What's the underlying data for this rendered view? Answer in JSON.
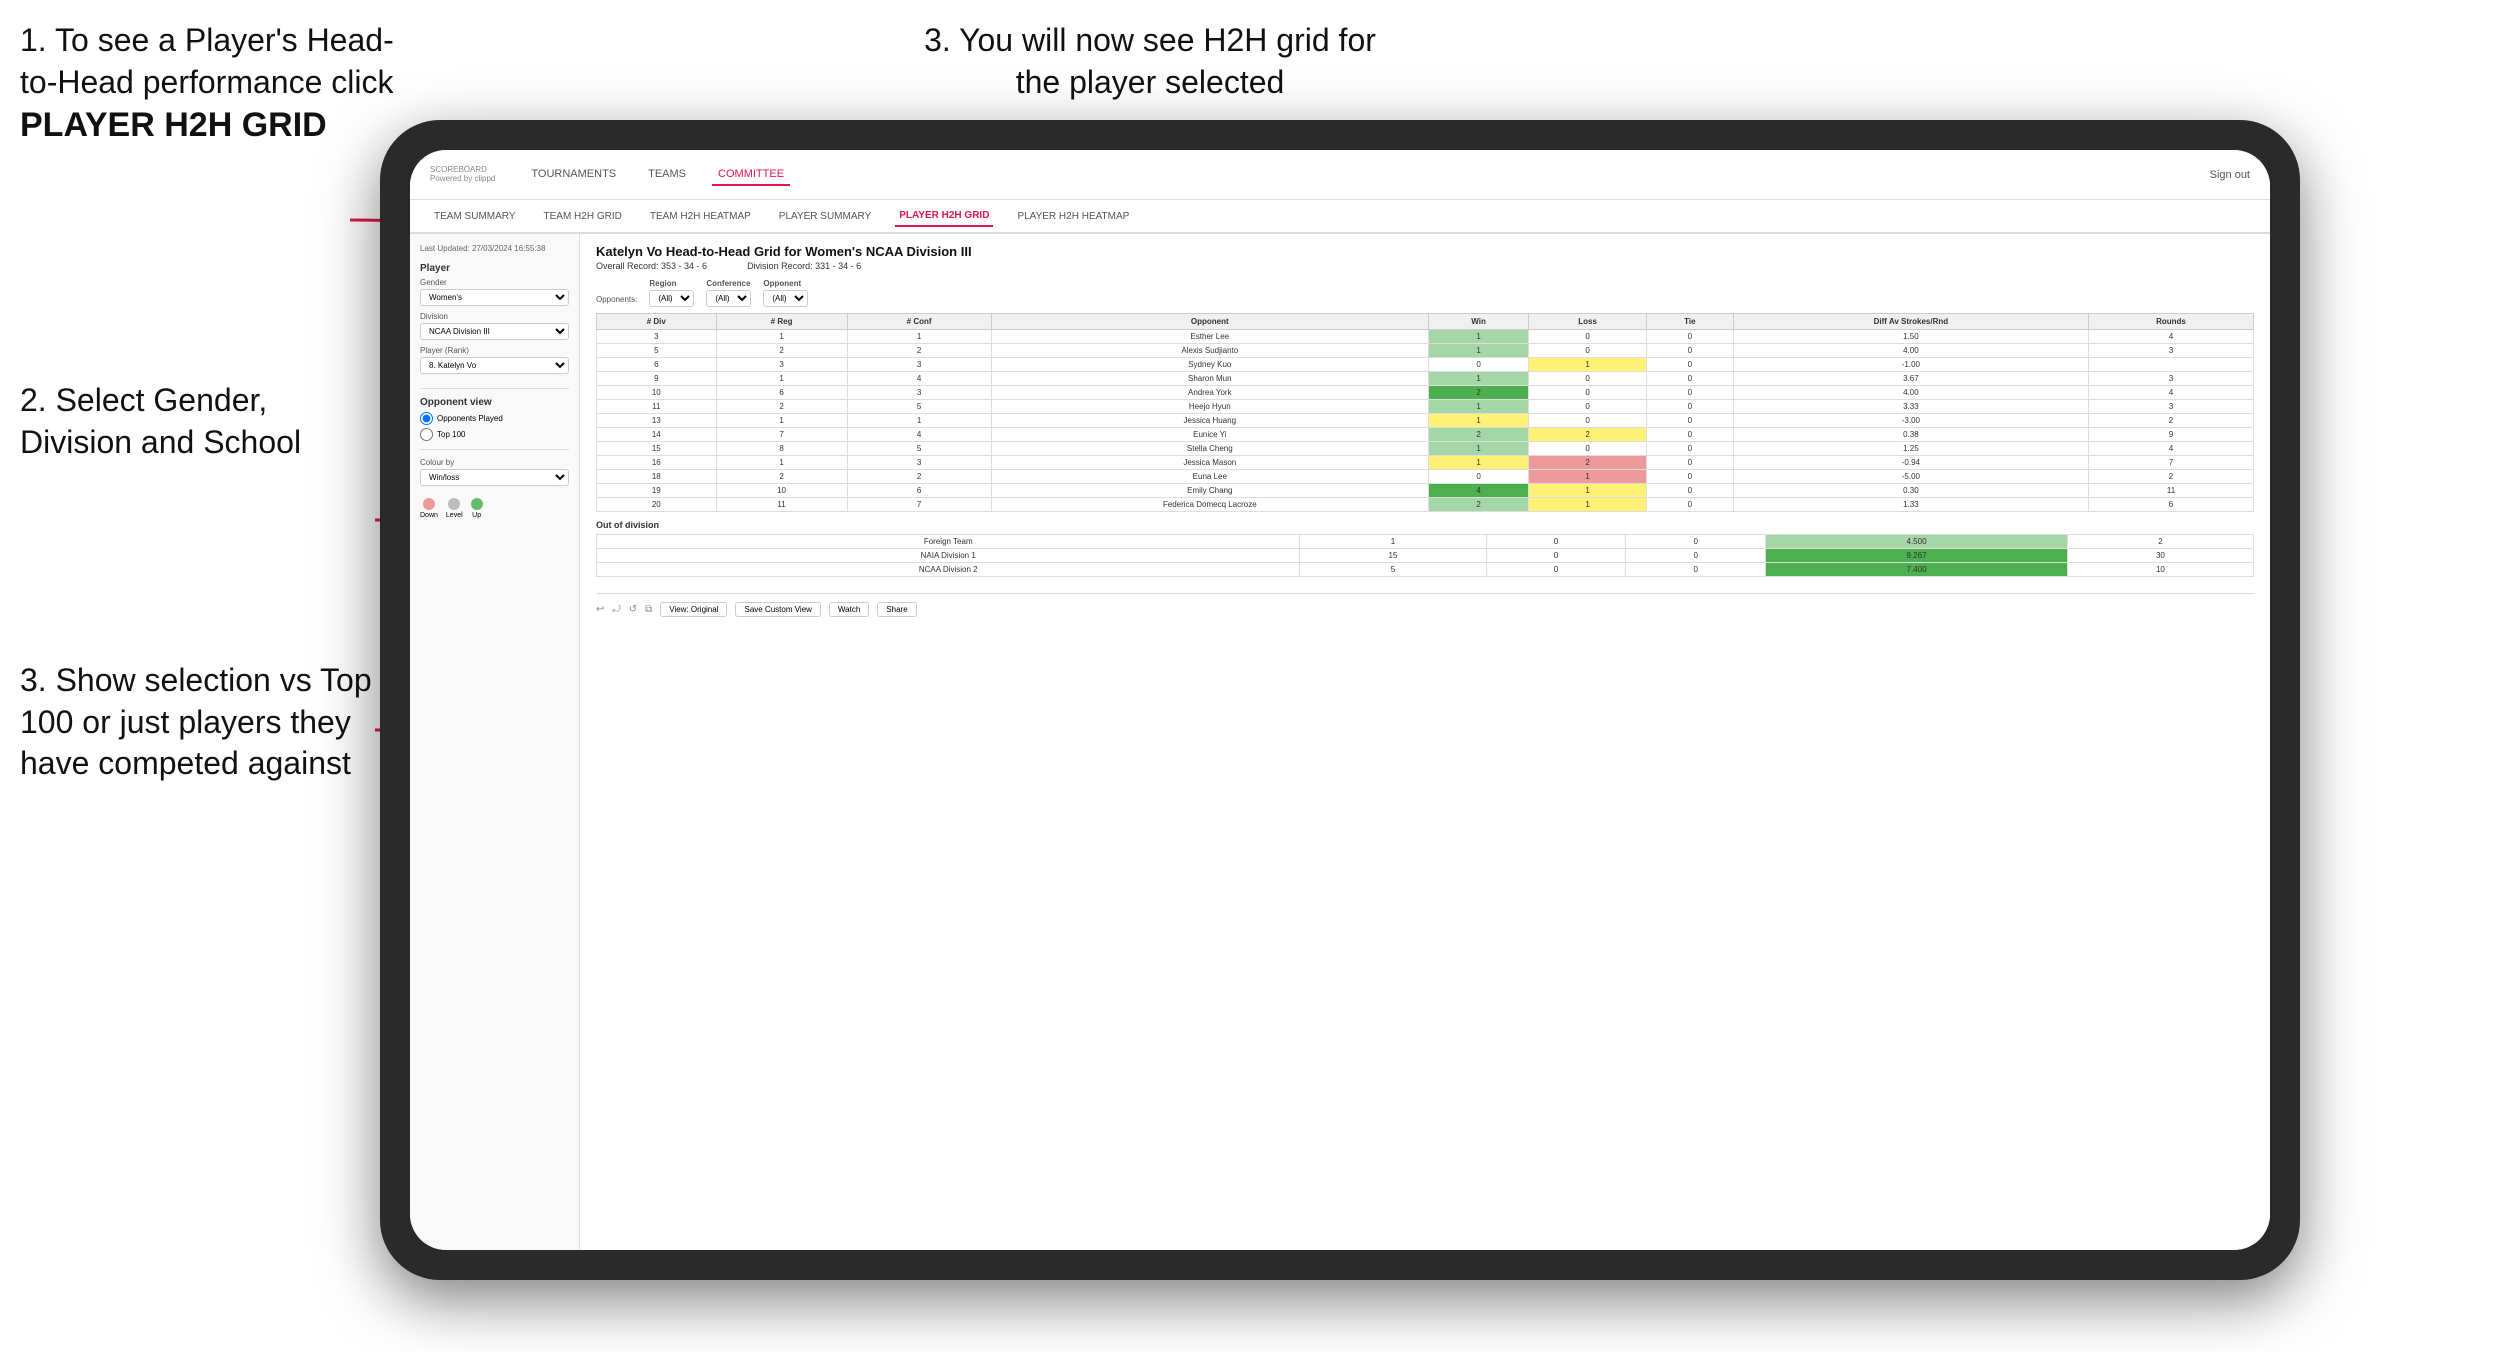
{
  "instructions": {
    "top_left_1": "1. To see a Player's Head-to-Head performance click",
    "top_left_bold": "PLAYER H2H GRID",
    "top_right": "3. You will now see H2H grid for the player selected",
    "mid_left": "2. Select Gender, Division and School",
    "bottom_left": "3. Show selection vs Top 100 or just players they have competed against"
  },
  "nav": {
    "logo": "SCOREBOARD",
    "logo_sub": "Powered by clippd",
    "links": [
      "TOURNAMENTS",
      "TEAMS",
      "COMMITTEE"
    ],
    "active_link": "COMMITTEE",
    "sign_out": "Sign out"
  },
  "sub_nav": {
    "links": [
      "TEAM SUMMARY",
      "TEAM H2H GRID",
      "TEAM H2H HEATMAP",
      "PLAYER SUMMARY",
      "PLAYER H2H GRID",
      "PLAYER H2H HEATMAP"
    ],
    "active": "PLAYER H2H GRID"
  },
  "sidebar": {
    "timestamp": "Last Updated: 27/03/2024 16:55:38",
    "player_section": "Player",
    "gender_label": "Gender",
    "gender_value": "Women's",
    "division_label": "Division",
    "division_value": "NCAA Division III",
    "player_rank_label": "Player (Rank)",
    "player_rank_value": "8. Katelyn Vo",
    "opponent_view_label": "Opponent view",
    "opponent_view_options": [
      "Opponents Played",
      "Top 100"
    ],
    "opponent_view_selected": "Opponents Played",
    "colour_by_label": "Colour by",
    "colour_by_value": "Win/loss",
    "legend": [
      {
        "label": "Down",
        "color": "#ef9a9a"
      },
      {
        "label": "Level",
        "color": "#bdbdbd"
      },
      {
        "label": "Up",
        "color": "#66bb6a"
      }
    ]
  },
  "grid": {
    "title": "Katelyn Vo Head-to-Head Grid for Women's NCAA Division III",
    "overall_record": "Overall Record: 353 - 34 - 6",
    "division_record": "Division Record: 331 - 34 - 6",
    "filters": {
      "region_label": "Region",
      "region_value": "(All)",
      "conference_label": "Conference",
      "conference_value": "(All)",
      "opponent_label": "Opponent",
      "opponent_value": "(All)",
      "opponents_label": "Opponents:"
    },
    "table_headers": [
      "# Div",
      "# Reg",
      "# Conf",
      "Opponent",
      "Win",
      "Loss",
      "Tie",
      "Diff Av Strokes/Rnd",
      "Rounds"
    ],
    "rows": [
      {
        "div": 3,
        "reg": 1,
        "conf": 1,
        "opponent": "Esther Lee",
        "win": 1,
        "loss": 0,
        "tie": 0,
        "diff": "1.50",
        "rounds": 4,
        "win_color": "green-light",
        "loss_color": "white"
      },
      {
        "div": 5,
        "reg": 2,
        "conf": 2,
        "opponent": "Alexis Sudjianto",
        "win": 1,
        "loss": 0,
        "tie": 0,
        "diff": "4.00",
        "rounds": 3,
        "win_color": "green-light",
        "loss_color": "white"
      },
      {
        "div": 6,
        "reg": 3,
        "conf": 3,
        "opponent": "Sydney Kuo",
        "win": 0,
        "loss": 1,
        "tie": 0,
        "diff": "-1.00",
        "rounds": "",
        "win_color": "white",
        "loss_color": "yellow"
      },
      {
        "div": 9,
        "reg": 1,
        "conf": 4,
        "opponent": "Sharon Mun",
        "win": 1,
        "loss": 0,
        "tie": 0,
        "diff": "3.67",
        "rounds": 3,
        "win_color": "green-light",
        "loss_color": "white"
      },
      {
        "div": 10,
        "reg": 6,
        "conf": 3,
        "opponent": "Andrea York",
        "win": 2,
        "loss": 0,
        "tie": 0,
        "diff": "4.00",
        "rounds": 4,
        "win_color": "green-dark",
        "loss_color": "white"
      },
      {
        "div": 11,
        "reg": 2,
        "conf": 5,
        "opponent": "Heejo Hyun",
        "win": 1,
        "loss": 0,
        "tie": 0,
        "diff": "3.33",
        "rounds": 3,
        "win_color": "green-light",
        "loss_color": "white"
      },
      {
        "div": 13,
        "reg": 1,
        "conf": 1,
        "opponent": "Jessica Huang",
        "win": 1,
        "loss": 0,
        "tie": 0,
        "diff": "-3.00",
        "rounds": 2,
        "win_color": "yellow",
        "loss_color": "white"
      },
      {
        "div": 14,
        "reg": 7,
        "conf": 4,
        "opponent": "Eunice Yi",
        "win": 2,
        "loss": 2,
        "tie": 0,
        "diff": "0.38",
        "rounds": 9,
        "win_color": "green-light",
        "loss_color": "yellow"
      },
      {
        "div": 15,
        "reg": 8,
        "conf": 5,
        "opponent": "Stella Cheng",
        "win": 1,
        "loss": 0,
        "tie": 0,
        "diff": "1.25",
        "rounds": 4,
        "win_color": "green-light",
        "loss_color": "white"
      },
      {
        "div": 16,
        "reg": 1,
        "conf": 3,
        "opponent": "Jessica Mason",
        "win": 1,
        "loss": 2,
        "tie": 0,
        "diff": "-0.94",
        "rounds": 7,
        "win_color": "yellow",
        "loss_color": "red-light"
      },
      {
        "div": 18,
        "reg": 2,
        "conf": 2,
        "opponent": "Euna Lee",
        "win": 0,
        "loss": 1,
        "tie": 0,
        "diff": "-5.00",
        "rounds": 2,
        "win_color": "white",
        "loss_color": "red-light"
      },
      {
        "div": 19,
        "reg": 10,
        "conf": 6,
        "opponent": "Emily Chang",
        "win": 4,
        "loss": 1,
        "tie": 0,
        "diff": "0.30",
        "rounds": 11,
        "win_color": "green-dark",
        "loss_color": "yellow"
      },
      {
        "div": 20,
        "reg": 11,
        "conf": 7,
        "opponent": "Federica Domecq Lacroze",
        "win": 2,
        "loss": 1,
        "tie": 0,
        "diff": "1.33",
        "rounds": 6,
        "win_color": "green-light",
        "loss_color": "yellow"
      }
    ],
    "out_of_division_title": "Out of division",
    "out_of_division_rows": [
      {
        "team": "Foreign Team",
        "win": 1,
        "loss": 0,
        "tie": 0,
        "diff": "4.500",
        "rounds": 2,
        "diff_color": "green-light"
      },
      {
        "team": "NAIA Division 1",
        "win": 15,
        "loss": 0,
        "tie": 0,
        "diff": "9.267",
        "rounds": 30,
        "diff_color": "green-dark"
      },
      {
        "team": "NCAA Division 2",
        "win": 5,
        "loss": 0,
        "tie": 0,
        "diff": "7.400",
        "rounds": 10,
        "diff_color": "green-dark"
      }
    ]
  },
  "toolbar": {
    "view_original": "View: Original",
    "save_custom": "Save Custom View",
    "watch": "Watch",
    "share": "Share"
  }
}
